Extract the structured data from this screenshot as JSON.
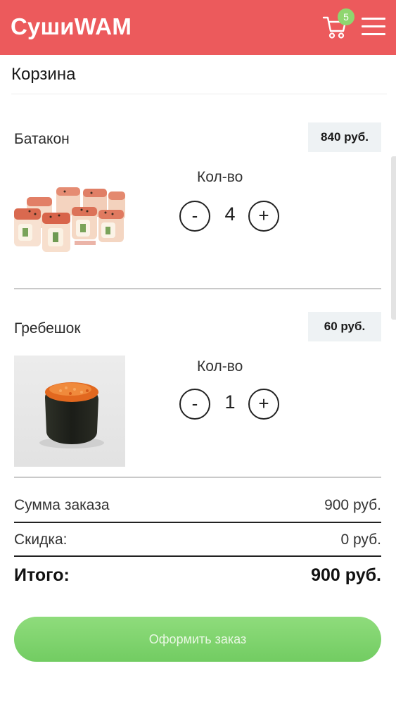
{
  "header": {
    "brand": "СушиWAM",
    "cart_count": "5",
    "cart_icon": "cart-icon",
    "menu_icon": "hamburger-menu-icon",
    "background_color": "#ec5a5c",
    "badge_color": "#8fd66f"
  },
  "page": {
    "title": "Корзина"
  },
  "cart": {
    "items": [
      {
        "name": "Батакон",
        "price": "840 руб.",
        "qty_label": "Кол-во",
        "quantity": "4",
        "minus_label": "-",
        "plus_label": "+"
      },
      {
        "name": "Гребешок",
        "price": "60 руб.",
        "qty_label": "Кол-во",
        "quantity": "1",
        "minus_label": "-",
        "plus_label": "+"
      }
    ]
  },
  "summary": {
    "subtotal_label": "Сумма заказа",
    "subtotal_value": "900 руб.",
    "discount_label": "Скидка:",
    "discount_value": "0 руб.",
    "total_label": "Итого:",
    "total_value": "900 руб."
  },
  "checkout": {
    "label": "Оформить заказ",
    "color": "#7ed46d"
  }
}
